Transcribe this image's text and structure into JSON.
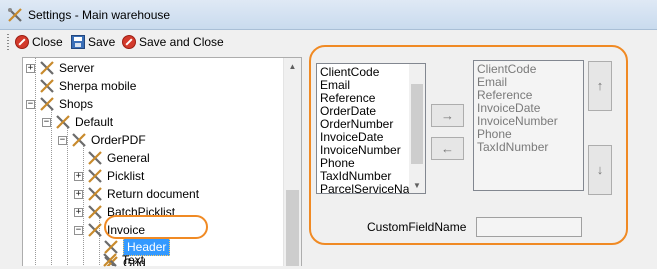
{
  "window": {
    "title": "Settings - Main warehouse",
    "app_icon": "tools-icon"
  },
  "toolbar": {
    "close_label": "Close",
    "save_label": "Save",
    "save_close_label": "Save and Close"
  },
  "tree": {
    "nodes": [
      {
        "label": "Server",
        "expander": "+"
      },
      {
        "label": "Sherpa mobile",
        "expander": ""
      },
      {
        "label": "Shops",
        "expander": "−"
      },
      {
        "label": "Default",
        "expander": "−"
      },
      {
        "label": "OrderPDF",
        "expander": "−"
      },
      {
        "label": "General",
        "expander": ""
      },
      {
        "label": "Picklist",
        "expander": "+"
      },
      {
        "label": "Return document",
        "expander": "+"
      },
      {
        "label": "BatchPicklist",
        "expander": "+"
      },
      {
        "label": "Invoice",
        "expander": "−"
      },
      {
        "label": "Header",
        "expander": "",
        "selected": true
      },
      {
        "label": "Grid",
        "expander": ""
      },
      {
        "label": "Text",
        "expander": ""
      }
    ]
  },
  "fields": {
    "available": [
      "ClientCode",
      "Email",
      "Reference",
      "OrderDate",
      "OrderNumber",
      "InvoiceDate",
      "InvoiceNumber",
      "Phone",
      "TaxIdNumber",
      "ParcelServiceNam"
    ],
    "selected": [
      "ClientCode",
      "Email",
      "Reference",
      "InvoiceDate",
      "InvoiceNumber",
      "Phone",
      "TaxIdNumber"
    ],
    "add_glyph": "→",
    "remove_glyph": "←",
    "up_glyph": "↑",
    "down_glyph": "↓",
    "custom_field_label": "CustomFieldName",
    "custom_field_value": ""
  },
  "colors": {
    "highlight": "#f08a24",
    "selection": "#3399ff"
  }
}
